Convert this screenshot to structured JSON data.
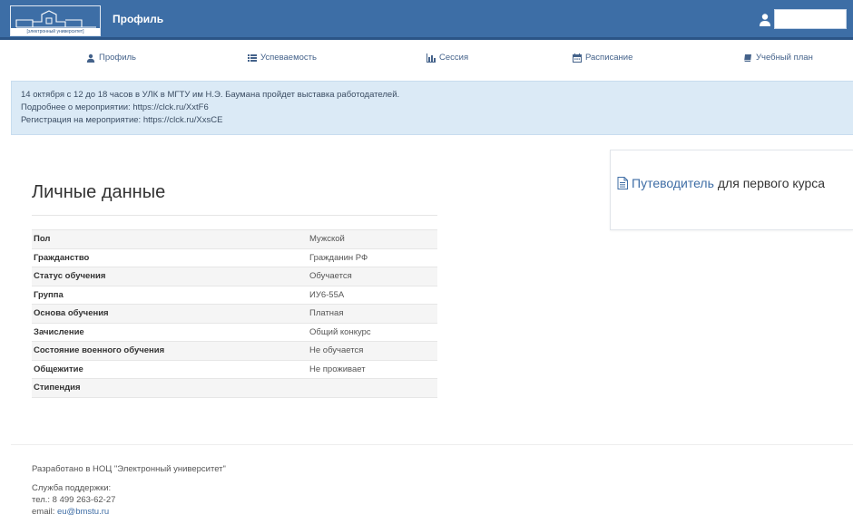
{
  "header": {
    "logo_caption": "[электронный университет]",
    "title": "Профиль",
    "user_name": ""
  },
  "nav": [
    {
      "icon": "user-icon",
      "label": "Профиль"
    },
    {
      "icon": "grades-icon",
      "label": "Успеваемость"
    },
    {
      "icon": "bar-chart-icon",
      "label": "Сессия"
    },
    {
      "icon": "calendar-icon",
      "label": "Расписание"
    },
    {
      "icon": "book-icon",
      "label": "Учебный план"
    }
  ],
  "notice": {
    "line1": "14 октября с 12 до 18 часов в УЛК в МГТУ им Н.Э. Баумана пройдет выставка работодателей.",
    "line2": "Подробнее о мероприятии: https://clck.ru/XxtF6",
    "line3": "Регистрация на мероприятие: https://clck.ru/XxsCE"
  },
  "guide": {
    "icon": "document-icon",
    "link_text": "Путеводитель",
    "rest_text": " для первого курса"
  },
  "personal": {
    "title": "Личные данные",
    "rows": [
      {
        "label": "Пол",
        "value": "Мужской"
      },
      {
        "label": "Гражданство",
        "value": "Гражданин РФ"
      },
      {
        "label": "Статус обучения",
        "value": "Обучается"
      },
      {
        "label": "Группа",
        "value": "ИУ6-55А"
      },
      {
        "label": "Основа обучения",
        "value": "Платная"
      },
      {
        "label": "Зачисление",
        "value": "Общий конкурс"
      },
      {
        "label": "Состояние военного обучения",
        "value": "Не обучается"
      },
      {
        "label": "Общежитие",
        "value": "Не проживает"
      },
      {
        "label": "Стипендия",
        "value": ""
      }
    ]
  },
  "footer": {
    "developed": "Разработано в НОЦ \"Электронный университет\"",
    "support_label": "Служба поддержки:",
    "phone": "тел.: 8 499 263-62-27",
    "email_label": "email: ",
    "email": "eu@bmstu.ru"
  },
  "colors": {
    "header_bg": "#3d6ea6",
    "notice_bg": "#dbeaf6",
    "link": "#3f6ea6"
  }
}
